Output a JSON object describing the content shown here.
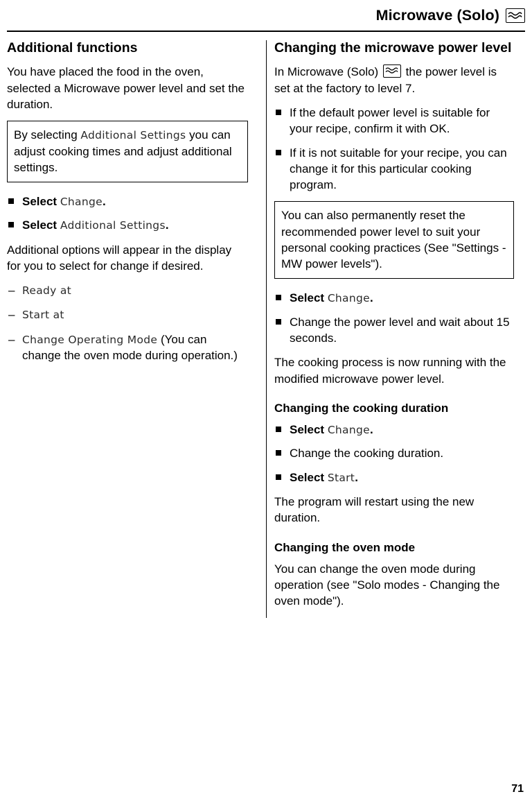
{
  "header": {
    "title": "Microwave (Solo)",
    "icon": "microwave-wave-icon"
  },
  "left": {
    "section_title": "Additional functions",
    "intro": "You have placed the food in the oven, selected a Microwave power level and set the duration.",
    "note": {
      "part1": "By selecting ",
      "display": "Additional Settings",
      "part2": " you can adjust cooking times and adjust additional settings."
    },
    "steps": [
      {
        "prefix": "Select ",
        "display": "Change",
        "suffix": "."
      },
      {
        "prefix": "Select ",
        "display": "Additional Settings",
        "suffix": "."
      }
    ],
    "paragraph": "Additional options will appear in the display for you to select for change if desired.",
    "options": [
      {
        "display": "Ready at",
        "suffix": ""
      },
      {
        "display": "Start at",
        "suffix": ""
      },
      {
        "display": "Change Operating Mode",
        "suffix": " (You can change the oven mode during operation.)"
      }
    ]
  },
  "right": {
    "section_title": "Changing the microwave power level",
    "intro_part1": "In Microwave (Solo) ",
    "intro_icon": "microwave-wave-icon",
    "intro_part2": " the power level is set at the factory to level 7.",
    "bullets": [
      "If the default power level is suitable for your recipe, confirm it with OK.",
      "If it is not suitable for your recipe, you can change it for this particular cooking program."
    ],
    "note": "You can also permanently reset the recommended power level to suit your personal cooking practices (See \"Settings - MW power levels\").",
    "steps": [
      {
        "prefix": "Select ",
        "display": "Change",
        "suffix": "."
      },
      {
        "prefix": "Change the power level and wait about 15 seconds.",
        "display": "",
        "suffix": ""
      }
    ],
    "after_steps": "The cooking process is now running with the modified microwave power level.",
    "subsection_duration": {
      "title": "Changing the cooking duration",
      "steps": [
        {
          "prefix": "Select ",
          "display": "Change",
          "suffix": "."
        },
        {
          "prefix": "Change the cooking duration.",
          "display": "",
          "suffix": ""
        },
        {
          "prefix": "Select ",
          "display": "Start",
          "suffix": "."
        }
      ],
      "after": "The program will restart using the new duration."
    },
    "subsection_mode": {
      "title": "Changing the oven mode",
      "body": "You can change the oven mode during operation (see \"Solo modes - Changing the oven mode\")."
    }
  },
  "footer": {
    "page_number": "71"
  }
}
